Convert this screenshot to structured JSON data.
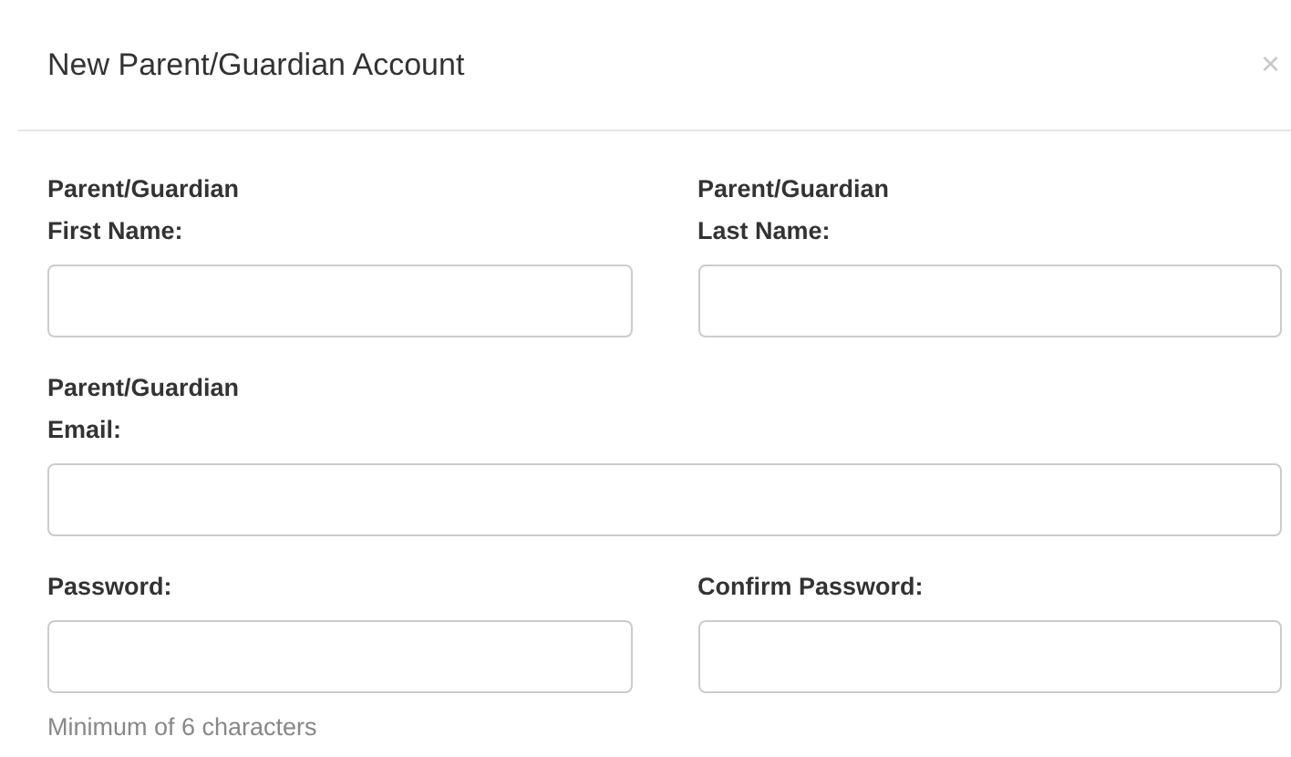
{
  "dialog": {
    "title": "New Parent/Guardian Account",
    "close": "×"
  },
  "rows": [
    {
      "fields": [
        {
          "label": "Parent/Guardian\nFirst Name:",
          "kind": "half"
        },
        {
          "label": "Parent/Guardian\nLast Name:",
          "kind": "half"
        }
      ]
    },
    {
      "fields": [
        {
          "label": "Parent/Guardian\nEmail:",
          "kind": "full"
        }
      ]
    },
    {
      "fields": [
        {
          "label": "Password:",
          "kind": "half",
          "help": "Minimum of 6 characters"
        },
        {
          "label": "Confirm Password:",
          "kind": "half"
        }
      ]
    }
  ]
}
